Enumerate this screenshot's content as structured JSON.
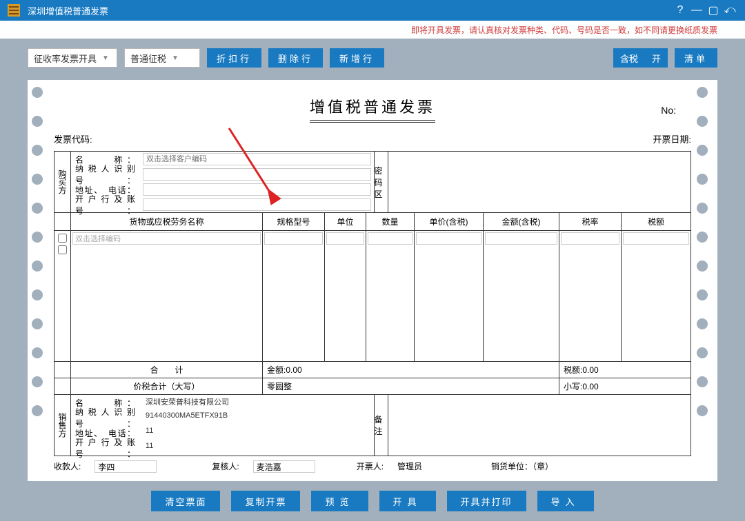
{
  "window": {
    "title": "深圳增值税普通发票"
  },
  "warning": "即将开具发票，请认真核对发票种类、代码、号码是否一致，如不同请更换纸质发票",
  "toolbar": {
    "combo1": "征收率发票开具",
    "combo2": "普通征税",
    "b_discount": "折扣行",
    "b_delrow": "删除行",
    "b_addrow": "新增行",
    "b_tax": "含税",
    "b_open": "开",
    "b_list": "清单"
  },
  "form": {
    "title": "增值税普通发票",
    "no_label": "No:",
    "code_label": "发票代码:",
    "date_label": "开票日期:",
    "buyer_side": "购买方",
    "seller_side": "销售方",
    "secret_side": "密码区",
    "remark_side": "备注",
    "f_name": "名　　称：",
    "f_taxid": "纳税人识别号：",
    "f_addr": "地址、　电话：",
    "f_bank": "开户行及账号：",
    "buyer_placeholder": "双击选择客户编码",
    "seller": {
      "name": "深圳安荣普科技有限公司",
      "taxid": "91440300MA5ETFX91B",
      "addr": "11",
      "bank": "11"
    },
    "cols": {
      "name": "货物或应税劳务名称",
      "spec": "规格型号",
      "unit": "单位",
      "qty": "数量",
      "price": "单价(含税)",
      "amt": "金额(含税)",
      "rate": "税率",
      "tax": "税额"
    },
    "row_placeholder": "双击选择编码",
    "sum_label": "合　　计",
    "sum_amt": "金额:0.00",
    "sum_tax": "税额:0.00",
    "total_label": "价税合计（大写）",
    "total_cn": "零圆整",
    "total_small_label": "小写:0.00",
    "payee_label": "收款人:",
    "payee": "李四",
    "checker_label": "复核人:",
    "checker": "麦浩嘉",
    "drawer_label": "开票人:",
    "drawer": "管理员",
    "unit_label": "销货单位：（章）"
  },
  "bottom": {
    "clear": "清空票面",
    "copy": "复制开票",
    "preview": "预览",
    "issue": "开具",
    "print": "开具并打印",
    "import": "导入"
  }
}
